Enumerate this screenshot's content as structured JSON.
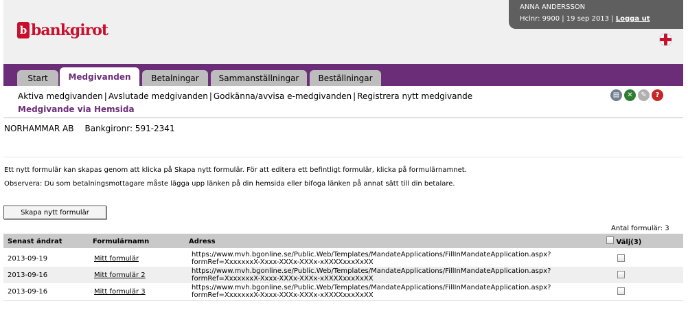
{
  "brand": {
    "mark": "b",
    "name": "bankgirot"
  },
  "user": {
    "name": "ANNA ANDERSSON",
    "info": "Hclnr: 9900 | 19 sep 2013 |",
    "logout_label": "Logga ut"
  },
  "tabs": [
    {
      "label": "Start",
      "active": false
    },
    {
      "label": "Medgivanden",
      "active": true
    },
    {
      "label": "Betalningar",
      "active": false
    },
    {
      "label": "Sammanställningar",
      "active": false
    },
    {
      "label": "Beställningar",
      "active": false
    }
  ],
  "subnav": {
    "links": [
      "Aktiva medgivanden",
      "Avslutade medgivanden",
      "Godkänna/avvisa e-medgivanden",
      "Registrera nytt medgivande"
    ],
    "separator": "|",
    "active": "Medgivande via Hemsida"
  },
  "tool_icons": [
    {
      "name": "print-icon",
      "color": "#6f7f8f",
      "glyph": "▤"
    },
    {
      "name": "excel-icon",
      "color": "#2e7d32",
      "glyph": "✕"
    },
    {
      "name": "pdf-icon",
      "color": "#b0b0b0",
      "glyph": "✎"
    },
    {
      "name": "help-icon",
      "color": "#c62828",
      "glyph": "?"
    }
  ],
  "company": {
    "name": "NORHAMMAR AB",
    "bankgiro": "Bankgironr: 591-2341"
  },
  "info_lines": [
    "Ett nytt formulär kan skapas genom att klicka på Skapa nytt formulär. För att editera ett befintligt formulär, klicka på formulärnamnet.",
    "Observera: Du som betalningsmottagare måste lägga upp länken på din hemsida eller bifoga länken på annat sätt till din betalare."
  ],
  "create_button": "Skapa nytt formulär",
  "count_text": "Antal formulär:  3",
  "table": {
    "headers": {
      "date": "Senast ändrat",
      "name": "Formulärnamn",
      "address": "Adress",
      "select": "Välj(3)"
    },
    "rows": [
      {
        "date": "2013-09-19",
        "name": "Mitt formulär",
        "address_line1": "https://www.mvh.bgonline.se/Public.Web/Templates/MandateApplications/FillInMandateApplication.aspx?",
        "address_line2": "formRef=XxxxxxxX-Xxxx-XXXx-XXXx-xXXXXxxxXxXX"
      },
      {
        "date": "2013-09-16",
        "name": "Mitt formulär 2",
        "address_line1": "https://www.mvh.bgonline.se/Public.Web/Templates/MandateApplications/FillInMandateApplication.aspx?",
        "address_line2": "formRef=XxxxxxxX-Xxxx-XXXx-XXXx-xXXXXxxxXxXX"
      },
      {
        "date": "2013-09-16",
        "name": "Mitt formulär 3",
        "address_line1": "https://www.mvh.bgonline.se/Public.Web/Templates/MandateApplications/FillInMandateApplication.aspx?",
        "address_line2": "formRef=XxxxxxxX-Xxxx-XXXx-XXXx-xXXXXxxxXxXX"
      }
    ]
  }
}
